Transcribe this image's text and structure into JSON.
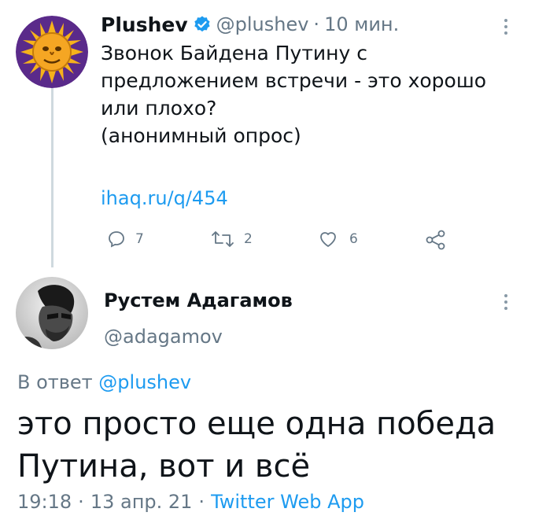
{
  "first_tweet": {
    "author_name": "Plushev",
    "handle": "@plushev",
    "separator": "·",
    "time_ago": "10 мин.",
    "text_lines": [
      "Звонок Байдена Путину с",
      "предложением встречи - это хорошо",
      "или плохо?",
      "(анонимный опрос)"
    ],
    "link": "ihaq.ru/q/454",
    "actions": {
      "replies": "7",
      "retweets": "2",
      "likes": "6"
    },
    "verified_color": "#1d9bf0"
  },
  "reply_tweet": {
    "author_name": "Рустем Адагамов",
    "handle": "@adagamov",
    "reply_prefix": "В ответ",
    "reply_to": "@plushev",
    "text_lines": [
      "это просто еще одна победа",
      "Путина, вот и всё"
    ],
    "time": "19:18",
    "date": "13 апр. 21",
    "source": "Twitter Web App"
  },
  "colors": {
    "link": "#1d9bf0",
    "muted": "#657786",
    "thread_line": "#cfd9de",
    "sun_avatar_bg": "#5a2a8a",
    "sun_avatar_face": "#f5a623"
  }
}
